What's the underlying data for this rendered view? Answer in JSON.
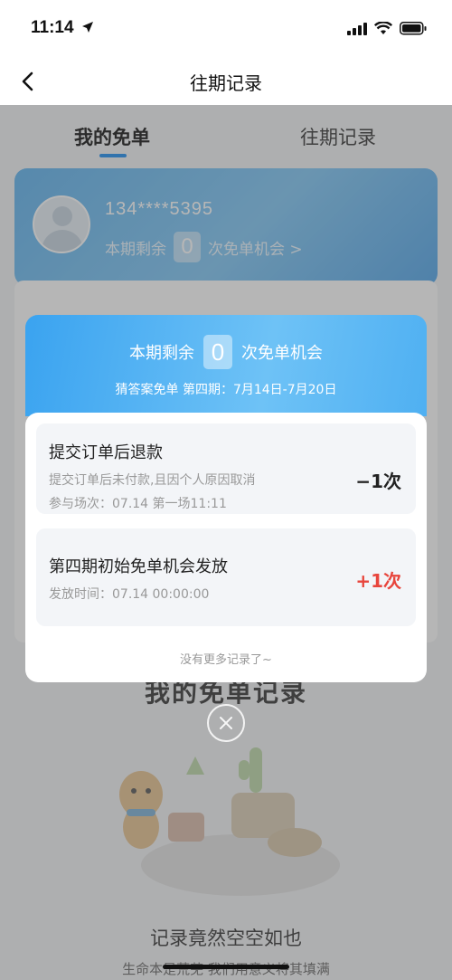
{
  "status_bar": {
    "time": "11:14"
  },
  "nav": {
    "title": "往期记录"
  },
  "tabs": [
    {
      "label": "我的免单",
      "active": true
    },
    {
      "label": "往期记录",
      "active": false
    }
  ],
  "user_card": {
    "phone": "134****5395",
    "remain_prefix": "本期剩余",
    "remain_count": "0",
    "remain_suffix": "次免单机会 >"
  },
  "background": {
    "record_section_title": "我的免单记录",
    "empty_title": "记录竟然空空如也",
    "empty_subtitle": "生命本是荒芜 我们用意义将其填满"
  },
  "modal": {
    "remain_prefix": "本期剩余",
    "remain_count": "0",
    "remain_suffix": "次免单机会",
    "period": "猜答案免单 第四期：7月14日-7月20日",
    "records": [
      {
        "title": "提交订单后退款",
        "desc": "提交订单后未付款,且因个人原因取消",
        "meta": "参与场次：07.14 第一场11:11",
        "amount": "−1次"
      },
      {
        "title": "第四期初始免单机会发放",
        "meta": "发放时间：07.14 00:00:00",
        "amount": "+1次"
      }
    ],
    "no_more": "没有更多记录了~"
  },
  "colors": {
    "accent_blue": "#1b8cf0",
    "plus_red": "#e8453c",
    "header_gradient_start": "#3aa3f0",
    "header_gradient_end": "#6ec2f6"
  },
  "icons": [
    "back-chevron-icon",
    "location-arrow-icon",
    "signal-icon",
    "wifi-icon",
    "battery-icon",
    "close-icon",
    "avatar-placeholder-icon"
  ]
}
